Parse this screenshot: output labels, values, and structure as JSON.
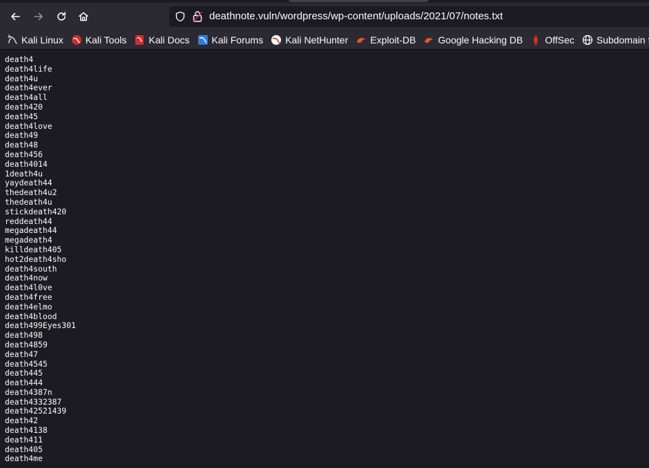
{
  "browser": {
    "url_host": "deathnote.vuln",
    "url_path": "/wordpress/wp-content/uploads/2021/07/notes.txt"
  },
  "bookmarks": [
    {
      "label": "Kali Linux",
      "icon": "kali-dragon-icon"
    },
    {
      "label": "Kali Tools",
      "icon": "kali-tools-icon"
    },
    {
      "label": "Kali Docs",
      "icon": "kali-docs-icon"
    },
    {
      "label": "Kali Forums",
      "icon": "kali-forums-icon"
    },
    {
      "label": "Kali NetHunter",
      "icon": "kali-nethunter-icon"
    },
    {
      "label": "Exploit-DB",
      "icon": "exploit-db-icon"
    },
    {
      "label": "Google Hacking DB",
      "icon": "ghdb-icon"
    },
    {
      "label": "OffSec",
      "icon": "offsec-icon"
    },
    {
      "label": "Subdomain finder -",
      "icon": "globe-icon"
    }
  ],
  "colors": {
    "background": "#1c1b22",
    "toolbar": "#2b2a33",
    "text": "#fbfbfe",
    "kali_red": "#d12d2d",
    "exploit_orange": "#e4572e"
  },
  "file_lines": [
    "death4",
    "death4life",
    "death4u",
    "death4ever",
    "death4all",
    "death420",
    "death45",
    "death4love",
    "death49",
    "death48",
    "death456",
    "death4014",
    "1death4u",
    "yaydeath44",
    "thedeath4u2",
    "thedeath4u",
    "stickdeath420",
    "reddeath44",
    "megadeath44",
    "megadeath4",
    "killdeath405",
    "hot2death4sho",
    "death4south",
    "death4now",
    "death4l0ve",
    "death4free",
    "death4elmo",
    "death4blood",
    "death499Eyes301",
    "death498",
    "death4859",
    "death47",
    "death4545",
    "death445",
    "death444",
    "death4387n",
    "death4332387",
    "death42521439",
    "death42",
    "death4138",
    "death411",
    "death405",
    "death4me"
  ]
}
